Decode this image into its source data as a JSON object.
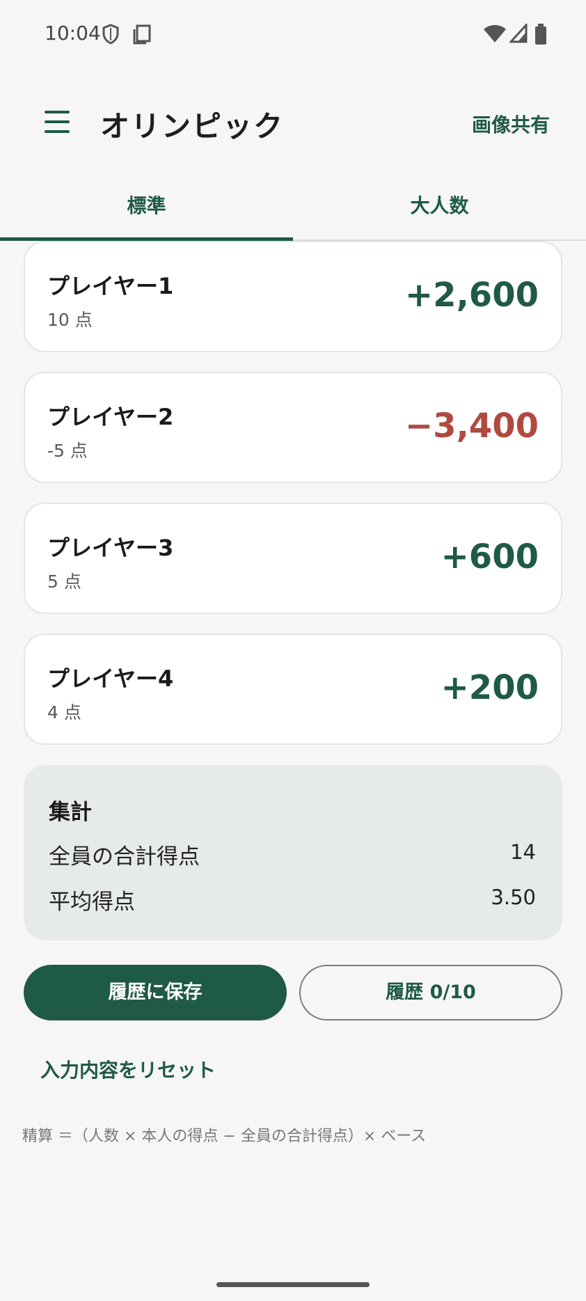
{
  "status_bar": {
    "time": "10:04"
  },
  "app_bar": {
    "title": "オリンピック",
    "share_label": "画像共有"
  },
  "tabs": [
    {
      "label": "標準",
      "selected": true
    },
    {
      "label": "大人数",
      "selected": false
    }
  ],
  "players": [
    {
      "name": "プレイヤー1",
      "points": "10 点",
      "settlement": "+2,600",
      "color": "#1f5a46"
    },
    {
      "name": "プレイヤー2",
      "points": "-5 点",
      "settlement": "−3,400",
      "color": "#b04a3e"
    },
    {
      "name": "プレイヤー3",
      "points": "5 点",
      "settlement": "+600",
      "color": "#1f5a46"
    },
    {
      "name": "プレイヤー4",
      "points": "4 点",
      "settlement": "+200",
      "color": "#1f5a46"
    }
  ],
  "summary": {
    "title": "集計",
    "total_label": "全員の合計得点",
    "total_value": "14",
    "avg_label": "平均得点",
    "avg_value": "3.50"
  },
  "actions": {
    "save_label": "履歴に保存",
    "history_label": "履歴 0/10",
    "reset_label": "入力内容をリセット"
  },
  "formula": "精算 ＝（人数 × 本人の得点 − 全員の合計得点）× ベース",
  "colors": {
    "primary": "#1f5a46",
    "negative": "#b04a3e",
    "background": "#f6f6f4"
  }
}
